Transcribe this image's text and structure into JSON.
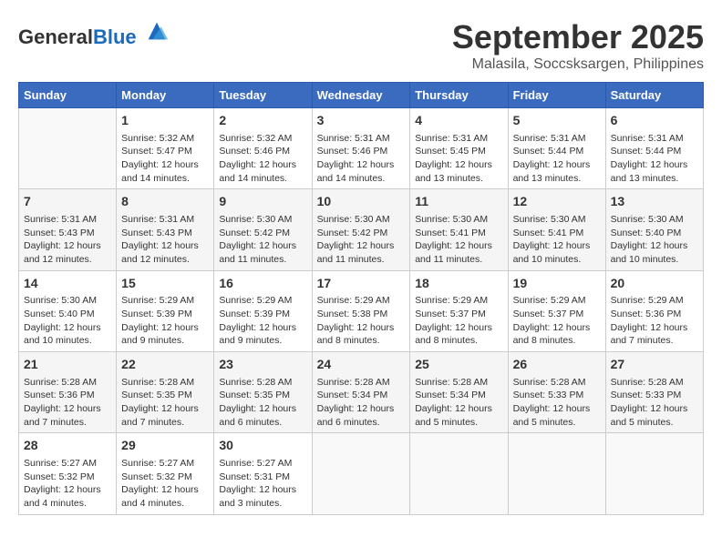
{
  "logo": {
    "general": "General",
    "blue": "Blue"
  },
  "title": "September 2025",
  "subtitle": "Malasila, Soccsksargen, Philippines",
  "weekdays": [
    "Sunday",
    "Monday",
    "Tuesday",
    "Wednesday",
    "Thursday",
    "Friday",
    "Saturday"
  ],
  "weeks": [
    [
      {
        "day": "",
        "detail": ""
      },
      {
        "day": "1",
        "detail": "Sunrise: 5:32 AM\nSunset: 5:47 PM\nDaylight: 12 hours\nand 14 minutes."
      },
      {
        "day": "2",
        "detail": "Sunrise: 5:32 AM\nSunset: 5:46 PM\nDaylight: 12 hours\nand 14 minutes."
      },
      {
        "day": "3",
        "detail": "Sunrise: 5:31 AM\nSunset: 5:46 PM\nDaylight: 12 hours\nand 14 minutes."
      },
      {
        "day": "4",
        "detail": "Sunrise: 5:31 AM\nSunset: 5:45 PM\nDaylight: 12 hours\nand 13 minutes."
      },
      {
        "day": "5",
        "detail": "Sunrise: 5:31 AM\nSunset: 5:44 PM\nDaylight: 12 hours\nand 13 minutes."
      },
      {
        "day": "6",
        "detail": "Sunrise: 5:31 AM\nSunset: 5:44 PM\nDaylight: 12 hours\nand 13 minutes."
      }
    ],
    [
      {
        "day": "7",
        "detail": "Sunrise: 5:31 AM\nSunset: 5:43 PM\nDaylight: 12 hours\nand 12 minutes."
      },
      {
        "day": "8",
        "detail": "Sunrise: 5:31 AM\nSunset: 5:43 PM\nDaylight: 12 hours\nand 12 minutes."
      },
      {
        "day": "9",
        "detail": "Sunrise: 5:30 AM\nSunset: 5:42 PM\nDaylight: 12 hours\nand 11 minutes."
      },
      {
        "day": "10",
        "detail": "Sunrise: 5:30 AM\nSunset: 5:42 PM\nDaylight: 12 hours\nand 11 minutes."
      },
      {
        "day": "11",
        "detail": "Sunrise: 5:30 AM\nSunset: 5:41 PM\nDaylight: 12 hours\nand 11 minutes."
      },
      {
        "day": "12",
        "detail": "Sunrise: 5:30 AM\nSunset: 5:41 PM\nDaylight: 12 hours\nand 10 minutes."
      },
      {
        "day": "13",
        "detail": "Sunrise: 5:30 AM\nSunset: 5:40 PM\nDaylight: 12 hours\nand 10 minutes."
      }
    ],
    [
      {
        "day": "14",
        "detail": "Sunrise: 5:30 AM\nSunset: 5:40 PM\nDaylight: 12 hours\nand 10 minutes."
      },
      {
        "day": "15",
        "detail": "Sunrise: 5:29 AM\nSunset: 5:39 PM\nDaylight: 12 hours\nand 9 minutes."
      },
      {
        "day": "16",
        "detail": "Sunrise: 5:29 AM\nSunset: 5:39 PM\nDaylight: 12 hours\nand 9 minutes."
      },
      {
        "day": "17",
        "detail": "Sunrise: 5:29 AM\nSunset: 5:38 PM\nDaylight: 12 hours\nand 8 minutes."
      },
      {
        "day": "18",
        "detail": "Sunrise: 5:29 AM\nSunset: 5:37 PM\nDaylight: 12 hours\nand 8 minutes."
      },
      {
        "day": "19",
        "detail": "Sunrise: 5:29 AM\nSunset: 5:37 PM\nDaylight: 12 hours\nand 8 minutes."
      },
      {
        "day": "20",
        "detail": "Sunrise: 5:29 AM\nSunset: 5:36 PM\nDaylight: 12 hours\nand 7 minutes."
      }
    ],
    [
      {
        "day": "21",
        "detail": "Sunrise: 5:28 AM\nSunset: 5:36 PM\nDaylight: 12 hours\nand 7 minutes."
      },
      {
        "day": "22",
        "detail": "Sunrise: 5:28 AM\nSunset: 5:35 PM\nDaylight: 12 hours\nand 7 minutes."
      },
      {
        "day": "23",
        "detail": "Sunrise: 5:28 AM\nSunset: 5:35 PM\nDaylight: 12 hours\nand 6 minutes."
      },
      {
        "day": "24",
        "detail": "Sunrise: 5:28 AM\nSunset: 5:34 PM\nDaylight: 12 hours\nand 6 minutes."
      },
      {
        "day": "25",
        "detail": "Sunrise: 5:28 AM\nSunset: 5:34 PM\nDaylight: 12 hours\nand 5 minutes."
      },
      {
        "day": "26",
        "detail": "Sunrise: 5:28 AM\nSunset: 5:33 PM\nDaylight: 12 hours\nand 5 minutes."
      },
      {
        "day": "27",
        "detail": "Sunrise: 5:28 AM\nSunset: 5:33 PM\nDaylight: 12 hours\nand 5 minutes."
      }
    ],
    [
      {
        "day": "28",
        "detail": "Sunrise: 5:27 AM\nSunset: 5:32 PM\nDaylight: 12 hours\nand 4 minutes."
      },
      {
        "day": "29",
        "detail": "Sunrise: 5:27 AM\nSunset: 5:32 PM\nDaylight: 12 hours\nand 4 minutes."
      },
      {
        "day": "30",
        "detail": "Sunrise: 5:27 AM\nSunset: 5:31 PM\nDaylight: 12 hours\nand 3 minutes."
      },
      {
        "day": "",
        "detail": ""
      },
      {
        "day": "",
        "detail": ""
      },
      {
        "day": "",
        "detail": ""
      },
      {
        "day": "",
        "detail": ""
      }
    ]
  ]
}
